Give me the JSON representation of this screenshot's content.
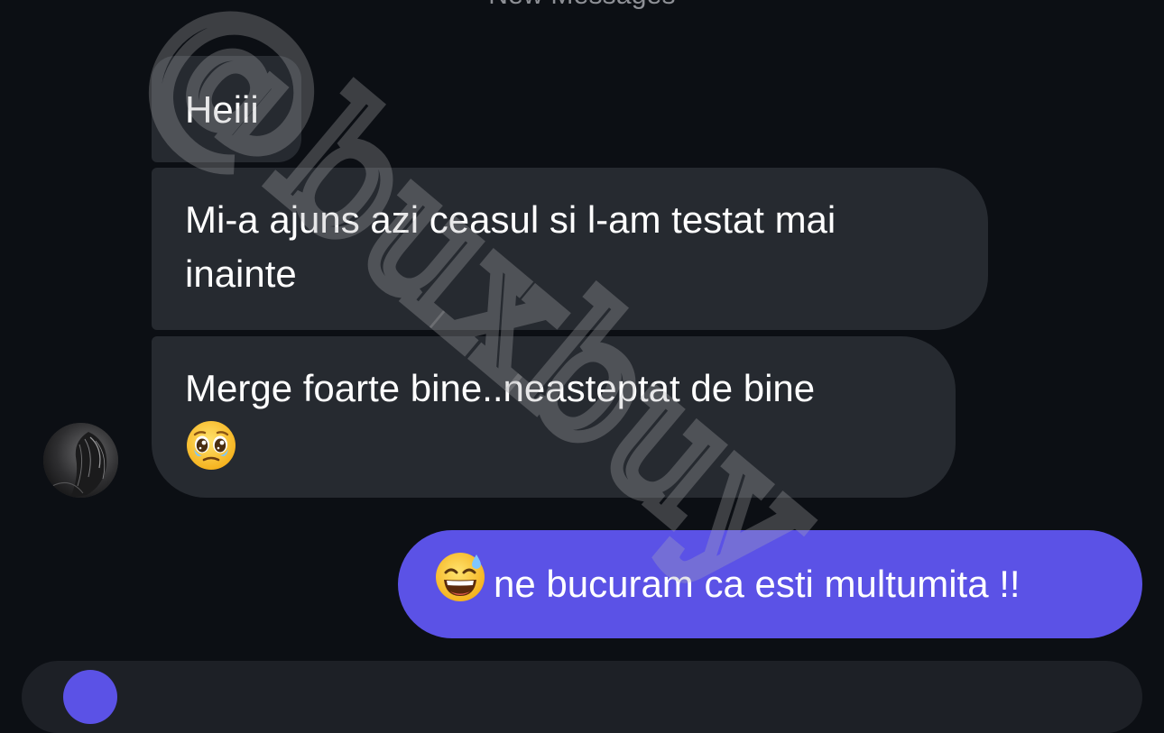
{
  "thread": {
    "divider_label": "New Messages"
  },
  "incoming": {
    "sender_avatar": "avatar-photo",
    "messages": [
      {
        "text": "Heiii"
      },
      {
        "text": "Mi-a ajuns azi ceasul si l-am testat mai inainte"
      },
      {
        "text": "Merge foarte bine..neasteptat de bine",
        "emoji": "pleading-face-emoji"
      }
    ]
  },
  "outgoing": {
    "messages": [
      {
        "emoji": "grinning-sweat-emoji",
        "text": "ne bucuram ca esti multumita !!"
      }
    ]
  },
  "watermark": {
    "text": "@buxbuy"
  },
  "colors": {
    "background": "#0c0f14",
    "incoming_bubble": "#262a30",
    "outgoing_bubble": "#5b52e6",
    "divider_text": "#8e9096"
  }
}
